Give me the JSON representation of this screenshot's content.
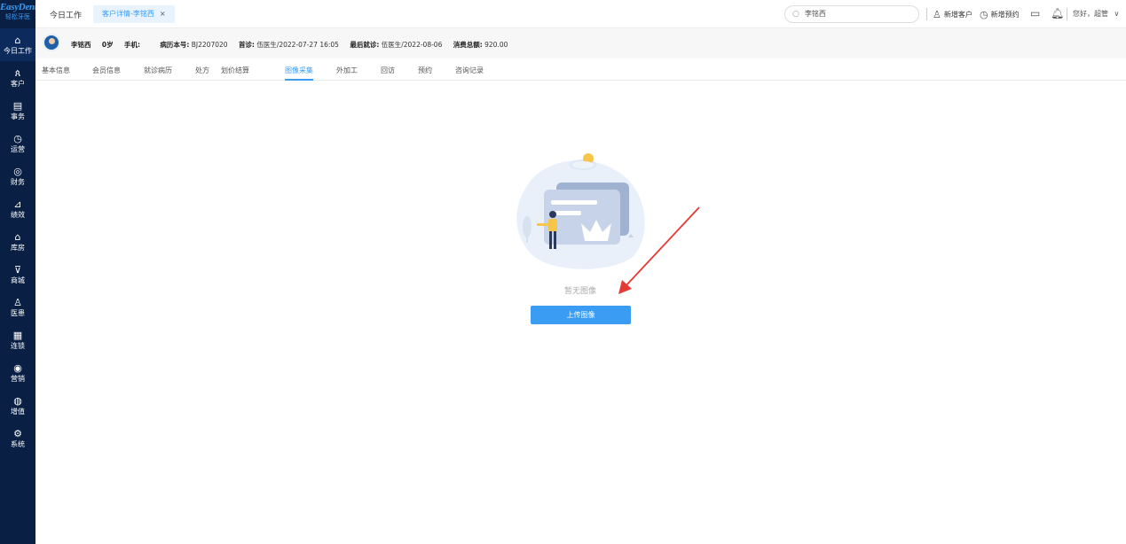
{
  "sidebar": {
    "brand": "EasyDent",
    "brand_sub": "轻松牙医",
    "items": [
      {
        "icon": "home-icon",
        "glyph": "⌂",
        "label": "今日工作"
      },
      {
        "icon": "user-icon",
        "glyph": "ጰ",
        "label": "客户"
      },
      {
        "icon": "calendar-icon",
        "glyph": "▤",
        "label": "事务"
      },
      {
        "icon": "clock-icon",
        "glyph": "◷",
        "label": "运营"
      },
      {
        "icon": "money-icon",
        "glyph": "◎",
        "label": "财务"
      },
      {
        "icon": "chart-icon",
        "glyph": "⊿",
        "label": "绩效"
      },
      {
        "icon": "warehouse-icon",
        "glyph": "⌂",
        "label": "库房"
      },
      {
        "icon": "cart-icon",
        "glyph": "⊽",
        "label": "商城"
      },
      {
        "icon": "doctor-icon",
        "glyph": "♙",
        "label": "医患"
      },
      {
        "icon": "chain-icon",
        "glyph": "▦",
        "label": "连锁"
      },
      {
        "icon": "marketing-icon",
        "glyph": "◉",
        "label": "营销"
      },
      {
        "icon": "value-added-icon",
        "glyph": "◍",
        "label": "增值"
      },
      {
        "icon": "settings-icon",
        "glyph": "⚙",
        "label": "系统"
      }
    ]
  },
  "topbar": {
    "home_tab": "今日工作",
    "active_tab": "客户详情-李铭西",
    "close_glyph": "×",
    "search_value": "李铭西",
    "new_customer": "新增客户",
    "new_appointment": "新增预约",
    "greeting": "您好，超管",
    "greeting_arrow": "∨"
  },
  "patient": {
    "name": "李铭西",
    "age": "0岁",
    "phone_label": "手机:",
    "phone_value": "",
    "record_label": "病历本号:",
    "record_value": "BJ2207020",
    "first_visit_label": "首诊:",
    "first_visit_value": "伍医生/2022-07-27 16:05",
    "last_visit_label": "最后就诊:",
    "last_visit_value": "伍医生/2022-08-06",
    "total_label": "消费总额:",
    "total_value": "920.00"
  },
  "subtabs": [
    "基本信息",
    "会员信息",
    "就诊病历",
    "处方",
    "划价结算",
    "图像采集",
    "外加工",
    "回访",
    "预约",
    "咨询记录"
  ],
  "main": {
    "empty_text": "暂无图像",
    "upload_label": "上传图像"
  },
  "colors": {
    "sidebar_bg": "#0a1f44",
    "accent": "#3b9cf4",
    "arrow": "#e53935"
  }
}
